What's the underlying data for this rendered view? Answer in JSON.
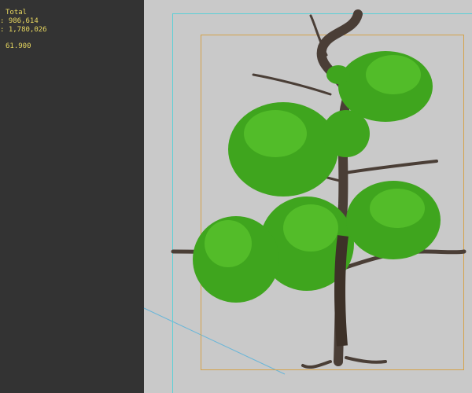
{
  "stats": {
    "header": "Total",
    "polys": ": 986,614",
    "verts": ": 1,780,026",
    "fps": "61.900"
  },
  "colors": {
    "panel": "#333333",
    "viewport": "#c9c9c9",
    "stat_text": "#e8d860",
    "safe_frame": "#5ccfd6",
    "render_frame": "#d4a24a",
    "foliage": "#3fa51e",
    "trunk": "#3d3128"
  }
}
